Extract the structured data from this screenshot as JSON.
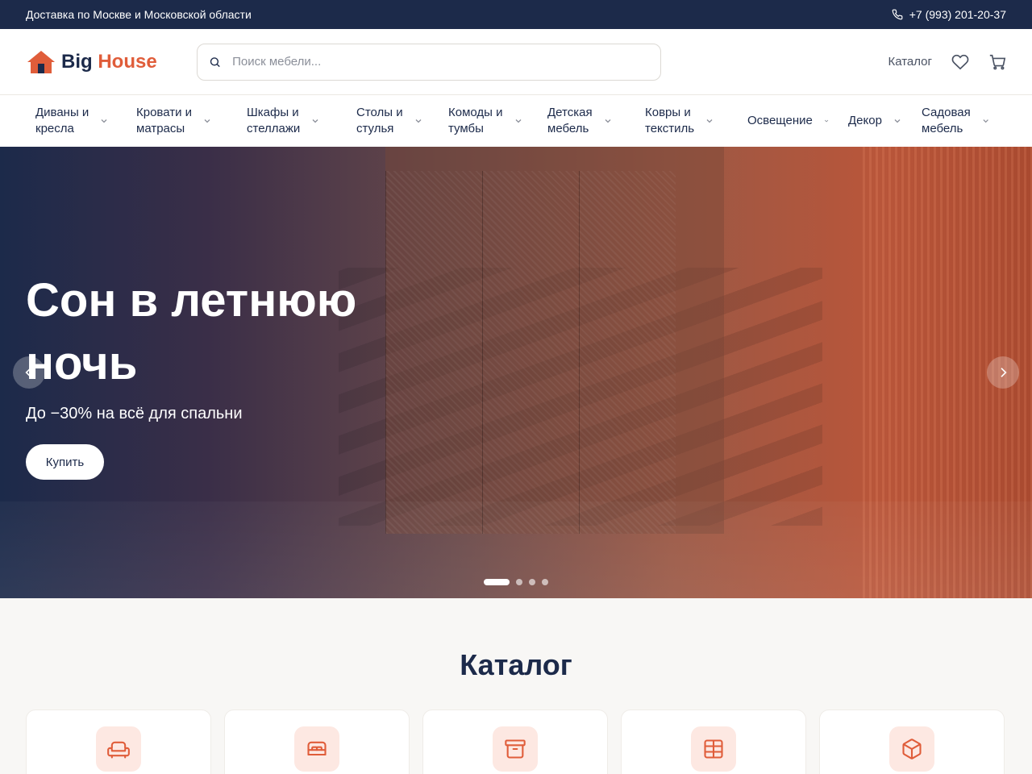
{
  "topbar": {
    "delivery": "Доставка по Москве и Московской области",
    "phone": "+7 (993) 201-20-37"
  },
  "header": {
    "logo_big": "Big",
    "logo_house": "House",
    "search_placeholder": "Поиск мебели...",
    "catalog_label": "Каталог",
    "icons": [
      "heart-icon",
      "cart-icon"
    ]
  },
  "nav": {
    "items": [
      {
        "label": "Диваны и\nкресла"
      },
      {
        "label": "Кровати и\nматрасы"
      },
      {
        "label": "Шкафы и\nстеллажи"
      },
      {
        "label": "Столы и\nстулья"
      },
      {
        "label": "Комоды и\nтумбы"
      },
      {
        "label": "Детская\nмебель"
      },
      {
        "label": "Ковры и\nтекстиль"
      },
      {
        "label": "Освещение"
      },
      {
        "label": "Декор"
      },
      {
        "label": "Садовая\nмебель"
      }
    ]
  },
  "hero": {
    "title": "Сон в летнюю ночь",
    "subtitle": "До −30% на всё для спальни",
    "button": "Купить",
    "slides_count": 4,
    "active_slide": 1
  },
  "catalog": {
    "title": "Каталог",
    "cards": [
      {
        "icon": "sofa-icon"
      },
      {
        "icon": "bed-icon"
      },
      {
        "icon": "archive-box-icon"
      },
      {
        "icon": "table-grid-icon"
      },
      {
        "icon": "package-cube-icon"
      }
    ]
  },
  "colors": {
    "navy": "#1c2a4a",
    "accent": "#e05d3a",
    "accent_soft": "#fde8e2"
  }
}
